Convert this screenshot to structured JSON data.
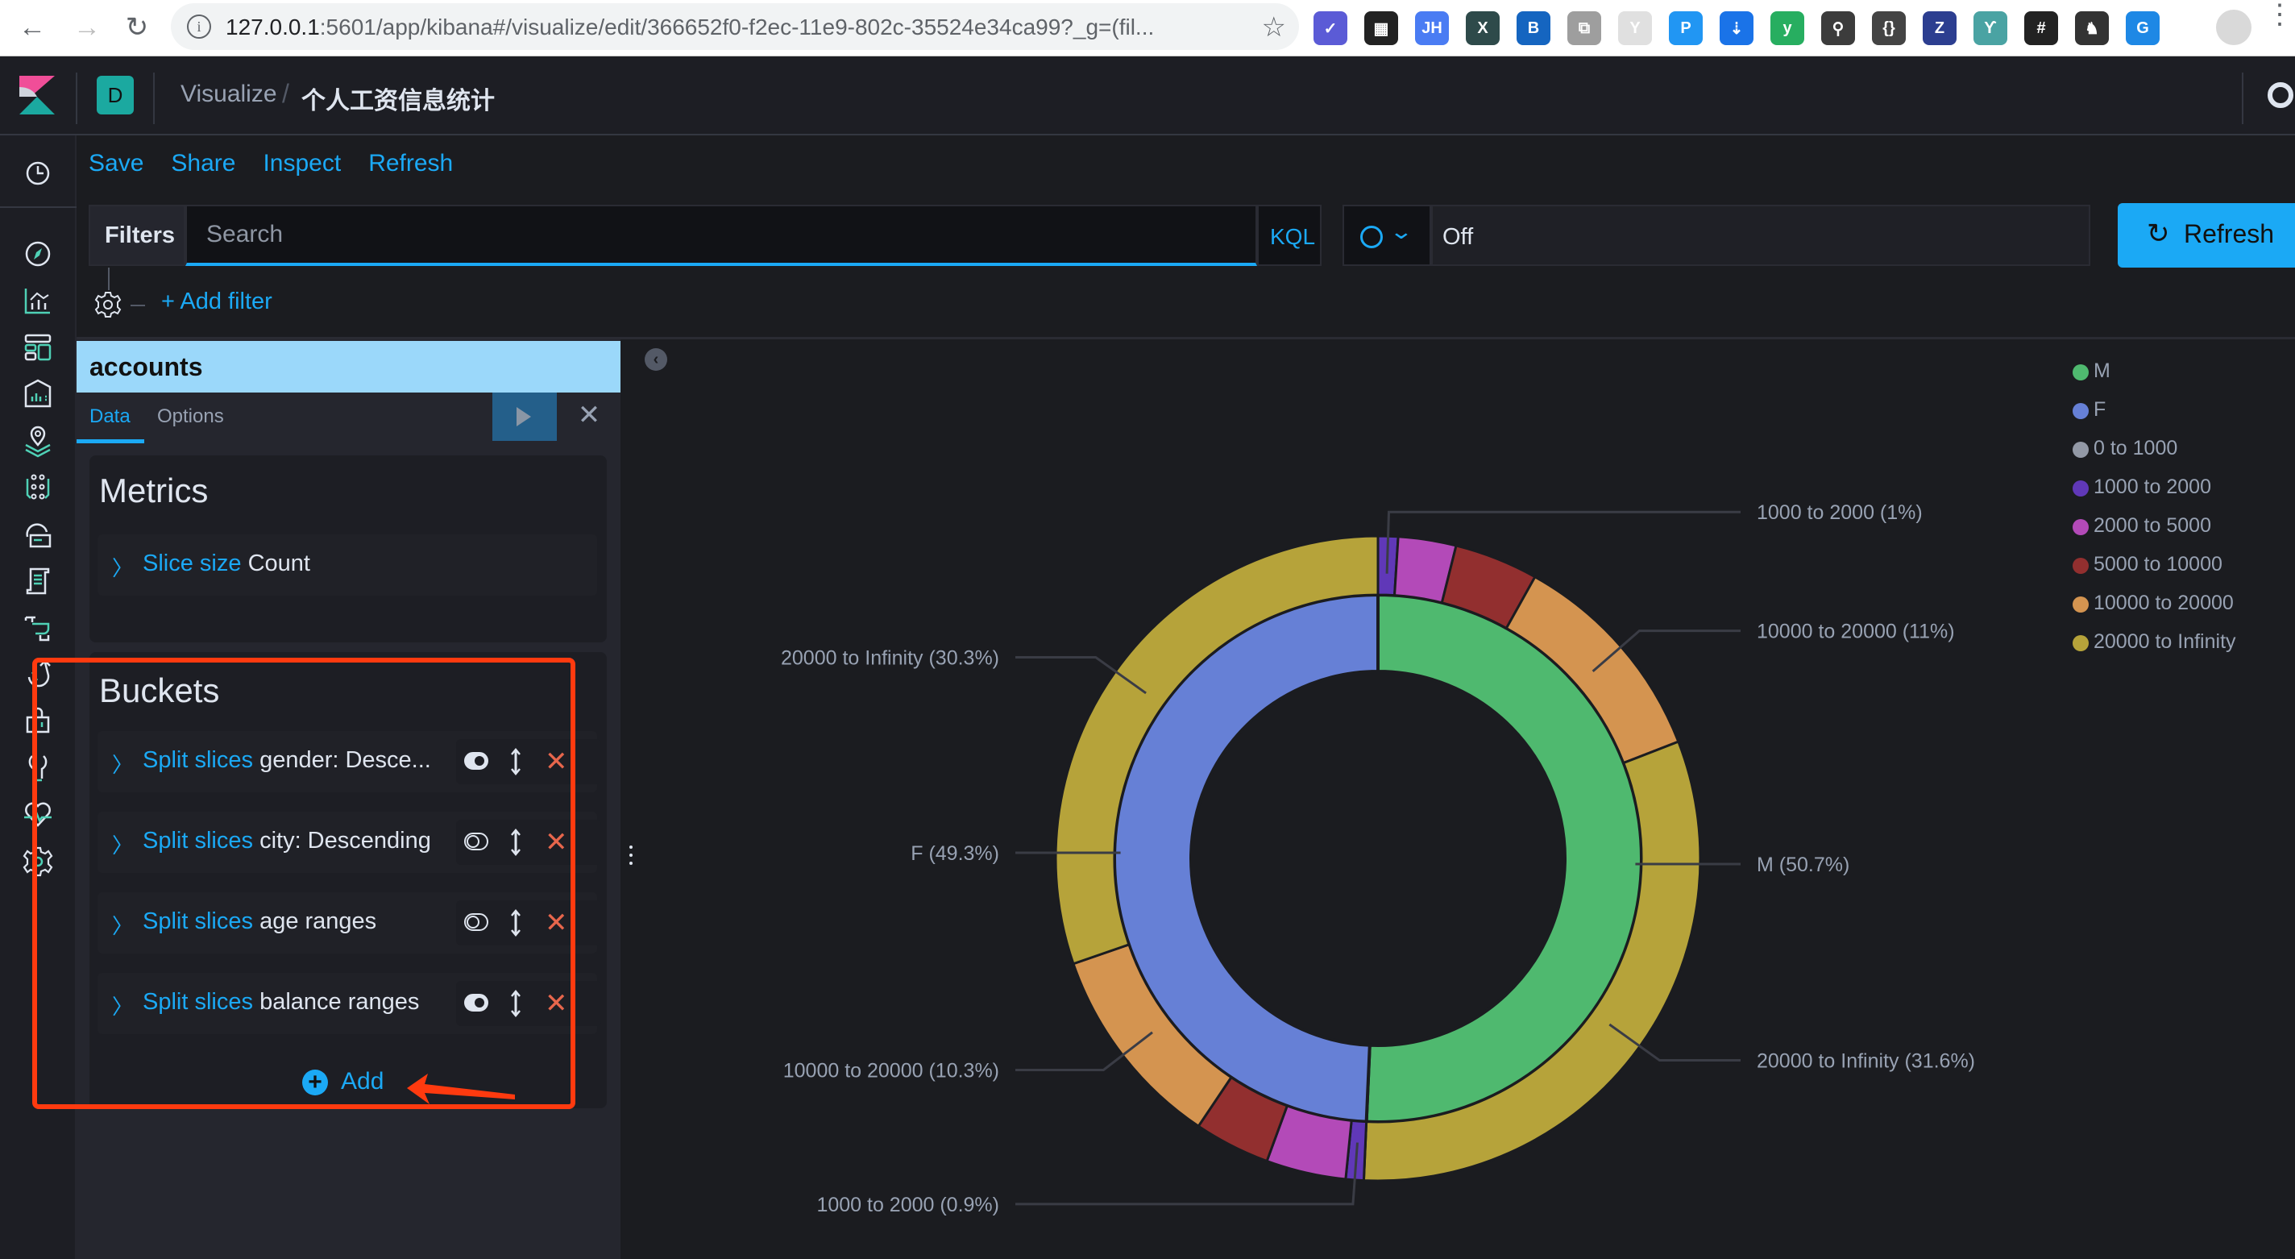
{
  "browser": {
    "back_label": "←",
    "forward_label": "→",
    "reload_label": "↻",
    "url_host": "127.0.0.1",
    "url_rest": ":5601/app/kibana#/visualize/edit/366652f0-f2ec-11e9-802c-35524e34ca99?_g=(fil...",
    "extensions": [
      {
        "name": "check-extension",
        "glyph": "✓",
        "color": "#5b5bd6"
      },
      {
        "name": "qr-extension",
        "glyph": "▦",
        "color": "#222222"
      },
      {
        "name": "jh-extension",
        "glyph": "JH",
        "color": "#4a7cf3"
      },
      {
        "name": "x-extension",
        "glyph": "X",
        "color": "#2e4a4a"
      },
      {
        "name": "b-extension",
        "glyph": "B",
        "color": "#1565c0"
      },
      {
        "name": "translate-extension",
        "glyph": "⧉",
        "color": "#9e9e9e"
      },
      {
        "name": "y-extension",
        "glyph": "Y",
        "color": "#e0e0e0"
      },
      {
        "name": "p-extension",
        "glyph": "P",
        "color": "#2196f3"
      },
      {
        "name": "download-extension",
        "glyph": "⇣",
        "color": "#1a73e8"
      },
      {
        "name": "v-extension",
        "glyph": "y",
        "color": "#27ae60"
      },
      {
        "name": "search-extension",
        "glyph": "⚲",
        "color": "#3c3c3c"
      },
      {
        "name": "json-extension",
        "glyph": "{}",
        "color": "#444444"
      },
      {
        "name": "z-extension",
        "glyph": "Z",
        "color": "#2c3e90"
      },
      {
        "name": "feather-extension",
        "glyph": "ϒ",
        "color": "#4aa3a3"
      },
      {
        "name": "hash-extension",
        "glyph": "#",
        "color": "#222222"
      },
      {
        "name": "spy-extension",
        "glyph": "♞",
        "color": "#333333"
      },
      {
        "name": "g-extension",
        "glyph": "G",
        "color": "#1e88e5"
      }
    ]
  },
  "header": {
    "space_initial": "D",
    "breadcrumb_parent": "Visualize",
    "breadcrumb_sep": "/",
    "breadcrumb_current": "个人工资信息统计"
  },
  "top_menu": {
    "save": "Save",
    "share": "Share",
    "inspect": "Inspect",
    "refresh": "Refresh"
  },
  "query_bar": {
    "filters_label": "Filters",
    "search_placeholder": "Search",
    "search_value": "",
    "language": "KQL",
    "refresh_interval": "Off",
    "refresh_button": "Refresh",
    "add_filter": "+ Add filter"
  },
  "editor": {
    "index_pattern": "accounts",
    "tabs": [
      {
        "label": "Data",
        "active": true
      },
      {
        "label": "Options",
        "active": false
      }
    ],
    "metrics_title": "Metrics",
    "metrics": [
      {
        "type": "Slice size",
        "desc": "Count"
      }
    ],
    "buckets_title": "Buckets",
    "buckets": [
      {
        "type": "Split slices",
        "desc": "gender: Desce...",
        "enabled": true
      },
      {
        "type": "Split slices",
        "desc": "city: Descending",
        "enabled": false
      },
      {
        "type": "Split slices",
        "desc": "age ranges",
        "enabled": false
      },
      {
        "type": "Split slices",
        "desc": "balance ranges",
        "enabled": true
      }
    ],
    "add_label": "Add"
  },
  "colors": {
    "accent": "#1ba9f5",
    "background": "#1b1c20",
    "annotation": "#ff3a0f"
  },
  "chart_data": {
    "type": "pie",
    "donut": true,
    "legend_position": "top-right",
    "legend": [
      {
        "label": "M",
        "color": "#4fb96f"
      },
      {
        "label": "F",
        "color": "#6680d6"
      },
      {
        "label": "0 to 1000",
        "color": "#9399a6"
      },
      {
        "label": "1000 to 2000",
        "color": "#6038b8"
      },
      {
        "label": "2000 to 5000",
        "color": "#b34ab8"
      },
      {
        "label": "5000 to 10000",
        "color": "#922f2f"
      },
      {
        "label": "10000 to 20000",
        "color": "#d49450"
      },
      {
        "label": "20000 to Infinity",
        "color": "#b6a33a"
      }
    ],
    "inner_ring": [
      {
        "label": "M",
        "percent": 50.7,
        "color": "#4fb96f"
      },
      {
        "label": "F",
        "percent": 49.3,
        "color": "#6680d6"
      }
    ],
    "outer_ring": [
      {
        "parent": "M",
        "label": "1000 to 2000",
        "percent": 1.0,
        "color": "#6038b8"
      },
      {
        "parent": "M",
        "label": "2000 to 5000",
        "percent": 2.9,
        "color": "#b34ab8"
      },
      {
        "parent": "M",
        "label": "5000 to 10000",
        "percent": 4.2,
        "color": "#922f2f"
      },
      {
        "parent": "M",
        "label": "10000 to 20000",
        "percent": 11.0,
        "color": "#d49450"
      },
      {
        "parent": "M",
        "label": "20000 to Infinity",
        "percent": 31.6,
        "color": "#b6a33a"
      },
      {
        "parent": "F",
        "label": "1000 to 2000",
        "percent": 0.9,
        "color": "#6038b8"
      },
      {
        "parent": "F",
        "label": "2000 to 5000",
        "percent": 4.0,
        "color": "#b34ab8"
      },
      {
        "parent": "F",
        "label": "5000 to 10000",
        "percent": 3.8,
        "color": "#922f2f"
      },
      {
        "parent": "F",
        "label": "10000 to 20000",
        "percent": 10.3,
        "color": "#d49450"
      },
      {
        "parent": "F",
        "label": "20000 to Infinity",
        "percent": 30.3,
        "color": "#b6a33a"
      }
    ],
    "data_labels": [
      {
        "text": "1000 to 2000 (1%)",
        "ring": "outer",
        "index": 0,
        "side": "right"
      },
      {
        "text": "10000 to 20000 (11%)",
        "ring": "outer",
        "index": 3,
        "side": "right"
      },
      {
        "text": "M (50.7%)",
        "ring": "inner",
        "index": 0,
        "side": "right"
      },
      {
        "text": "20000 to Infinity (31.6%)",
        "ring": "outer",
        "index": 4,
        "side": "right"
      },
      {
        "text": "20000 to Infinity (30.3%)",
        "ring": "outer",
        "index": 9,
        "side": "left"
      },
      {
        "text": "F (49.3%)",
        "ring": "inner",
        "index": 1,
        "side": "left"
      },
      {
        "text": "10000 to 20000 (10.3%)",
        "ring": "outer",
        "index": 8,
        "side": "left"
      },
      {
        "text": "1000 to 2000 (0.9%)",
        "ring": "outer",
        "index": 5,
        "side": "left"
      }
    ]
  }
}
